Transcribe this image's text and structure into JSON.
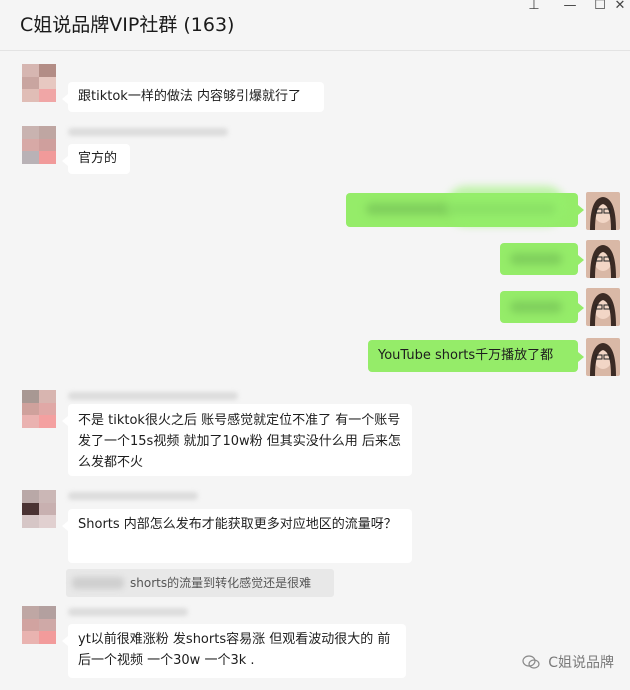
{
  "window": {
    "title": "C姐说品牌VIP社群 (163)",
    "controls": {
      "pin": "⊥",
      "minimize": "—",
      "maximize": "☐",
      "close": "✕"
    }
  },
  "messages": [
    {
      "side": "in",
      "text": "跟tiktok一样的做法 内容够引爆就行了"
    },
    {
      "side": "in",
      "text": "官方的"
    },
    {
      "side": "out",
      "text": "",
      "blurred": true
    },
    {
      "side": "out",
      "text": "",
      "blurred": true
    },
    {
      "side": "out",
      "text": "",
      "blurred": true
    },
    {
      "side": "out",
      "text": "YouTube shorts千万播放了都"
    },
    {
      "side": "in",
      "text": "不是 tiktok很火之后 账号感觉就定位不准了   有一个账号发了一个15s视频 就加了10w粉 但其实没什么用 后来怎么发都不火"
    },
    {
      "side": "in",
      "text": "Shorts 内部怎么发布才能获取更多对应地区的流量呀？",
      "quote": "shorts的流量到转化感觉还是很难"
    },
    {
      "side": "in",
      "text": "yt以前很难涨粉 发shorts容易涨 但观看波动很大的 前后一个视频 一个30w 一个3k ."
    }
  ],
  "watermark": {
    "text": "C姐说品牌"
  },
  "colors": {
    "background": "#f5f5f5",
    "incoming_bubble": "#ffffff",
    "outgoing_bubble": "#95ec69"
  }
}
